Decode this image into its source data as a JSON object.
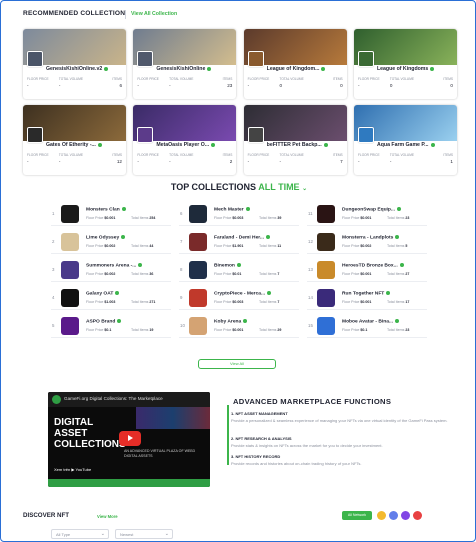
{
  "recommended": {
    "title": "RECOMMENDED COLLECTION",
    "view_all": "View All Collection",
    "stat_labels": [
      "FLOOR PRICE",
      "TOTAL VOLUME",
      "ITEMS"
    ],
    "cards": [
      {
        "name": "GenesisKishiOnline.v2",
        "floor": "-",
        "volume": "-",
        "items": "6",
        "banner_from": "#7d8a9c",
        "banner_to": "#c9b48a",
        "thumb": "#4b5568"
      },
      {
        "name": "GenesisKishiOnline",
        "floor": "-",
        "volume": "-",
        "items": "23",
        "banner_from": "#6f7c8f",
        "banner_to": "#d3bd8e",
        "thumb": "#50596c"
      },
      {
        "name": "League of Kingdom...",
        "floor": "-",
        "volume": "0",
        "items": "0",
        "banner_from": "#5b3a2c",
        "banner_to": "#b77a3b",
        "thumb": "#8a5a2e"
      },
      {
        "name": "League of Kingdoms",
        "floor": "-",
        "volume": "0",
        "items": "0",
        "banner_from": "#2f5f2e",
        "banner_to": "#89b25a",
        "thumb": "#3b6a34"
      },
      {
        "name": "Gates Of Etherity -...",
        "floor": "-",
        "volume": "-",
        "items": "12",
        "banner_from": "#3d3020",
        "banner_to": "#8c6a3b",
        "thumb": "#2a2a2a"
      },
      {
        "name": "MetaOasis Player O...",
        "floor": "-",
        "volume": "-",
        "items": "2",
        "banner_from": "#3a2b66",
        "banner_to": "#7a4ab0",
        "thumb": "#5c3b8a"
      },
      {
        "name": "beFITTER Pet Backp...",
        "floor": "-",
        "volume": "-",
        "items": "7",
        "banner_from": "#2d2d34",
        "banner_to": "#6b4e6e",
        "thumb": "#444"
      },
      {
        "name": "Aqua Farm Game P...",
        "floor": "-",
        "volume": "-",
        "items": "1",
        "banner_from": "#2f6fb0",
        "banner_to": "#9ad0ef",
        "thumb": "#2f7ac0"
      }
    ]
  },
  "top": {
    "title_a": "TOP COLLECTIONS",
    "title_b": "ALL TIME",
    "chevron": "⌄",
    "floor_label": "Floor Price",
    "total_label": "Total Items",
    "view_all": "View All",
    "items": [
      {
        "rank": "1",
        "name": "Monsters Clan",
        "floor": "$0.001",
        "total": "254",
        "color": "#1b1b1b"
      },
      {
        "rank": "6",
        "name": "Mech Master",
        "floor": "$0.003",
        "total": "39",
        "color": "#1e2a3a"
      },
      {
        "rank": "11",
        "name": "DungeonSwap Equip...",
        "floor": "$0.001",
        "total": "23",
        "color": "#2a1414"
      },
      {
        "rank": "2",
        "name": "Lime Odyssey",
        "floor": "$0.002",
        "total": "44",
        "color": "#d8c39a"
      },
      {
        "rank": "7",
        "name": "Faraland - Demi Her...",
        "floor": "$1.901",
        "total": "11",
        "color": "#7a2a2a"
      },
      {
        "rank": "12",
        "name": "Monsterra - Landplots",
        "floor": "$0.002",
        "total": "5",
        "color": "#3a2a1a"
      },
      {
        "rank": "3",
        "name": "Summoners Arena -...",
        "floor": "$0.002",
        "total": "36",
        "color": "#4a3a8a"
      },
      {
        "rank": "8",
        "name": "Binemon",
        "floor": "$0.01",
        "total": "7",
        "color": "#1f2f4a"
      },
      {
        "rank": "13",
        "name": "HeroesTD Bronze Box...",
        "floor": "$0.001",
        "total": "27",
        "color": "#c98a2a"
      },
      {
        "rank": "4",
        "name": "Galaxy OAT",
        "floor": "$1.003",
        "total": "271",
        "color": "#111111"
      },
      {
        "rank": "9",
        "name": "CryptoPiece - Merca...",
        "floor": "$0.003",
        "total": "7",
        "color": "#c0392b"
      },
      {
        "rank": "14",
        "name": "Run Together NFT",
        "floor": "$0.001",
        "total": "17",
        "color": "#3a2a7a"
      },
      {
        "rank": "5",
        "name": "ASPO Brand",
        "floor": "$0.1",
        "total": "19",
        "color": "#5a1a8a"
      },
      {
        "rank": "10",
        "name": "Koby Arena",
        "floor": "$0.001",
        "total": "29",
        "color": "#d4a373"
      },
      {
        "rank": "15",
        "name": "Moboe Avatar - Bina...",
        "floor": "$0.1",
        "total": "23",
        "color": "#2f6fd6"
      }
    ]
  },
  "video": {
    "channel_title": "GameFi.org Digital Collections: The Marketplace",
    "headline": "DIGITAL ASSET COLLECTIONS",
    "subline": "AN ADVANCED VIRTUAL PLAZA OF WEB3 DIGITAL ASSETS",
    "yt_label": "Xem trên ▶ YouTube"
  },
  "advanced": {
    "title": "ADVANCED MARKETPLACE FUNCTIONS",
    "features": [
      {
        "heading": "1. NFT ASSET MANAGEMENT",
        "desc": "Provide a personalized & seamless experience of managing your NFTs via one virtual identity of the GameFi Pass system."
      },
      {
        "heading": "2. NFT RESEARCH & ANALYSIS",
        "desc": "Provide stats & insights on NFTs across the market for you to decide your investment."
      },
      {
        "heading": "3. NFT HISTORY RECORD",
        "desc": "Provide records and histories about on-chain trading history of your NFTs."
      }
    ]
  },
  "discover": {
    "title": "DISCOVER NFT",
    "view_more": "View More",
    "network_button": "All Network",
    "type_select": "All Type",
    "sort_select": "Newest"
  }
}
